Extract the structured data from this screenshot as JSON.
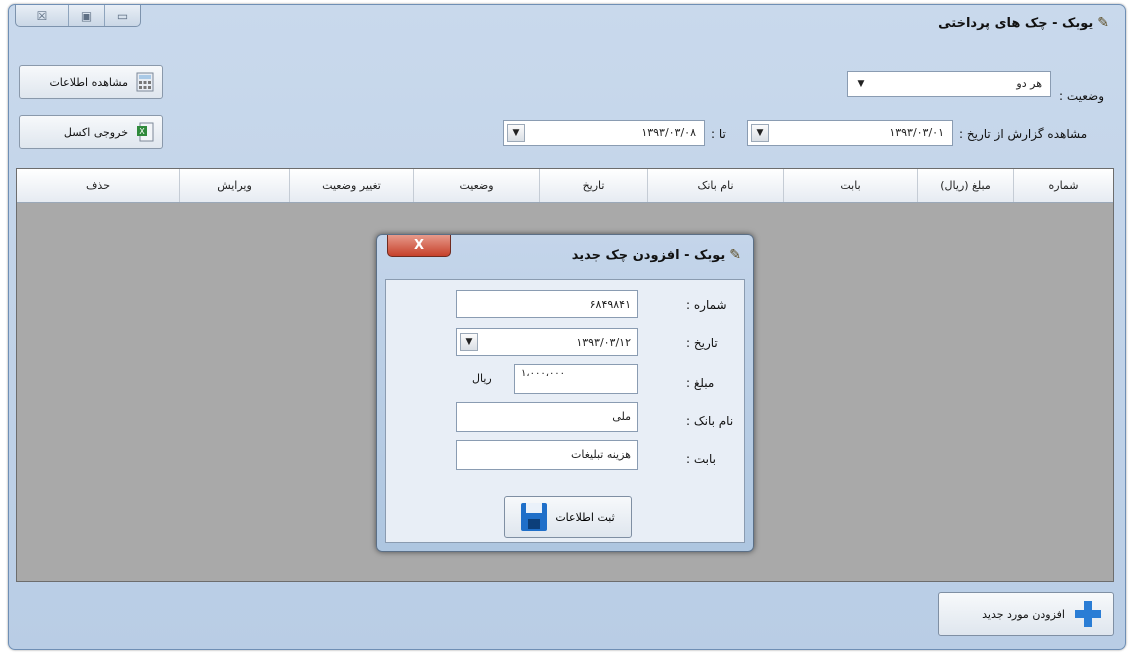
{
  "window": {
    "title": "یوبک - چک های پرداختی",
    "controls": [
      "☒",
      "▣",
      "▭"
    ]
  },
  "toolbar": {
    "view_info_label": "مشاهده اطلاعات",
    "excel_label": "خروجی اکسل"
  },
  "filters": {
    "status_label": "وضعیت :",
    "status_value": "هر دو",
    "report_from_label": "مشاهده گزارش از تاریخ :",
    "from_date": "۱۳۹۳/۰۳/۰۱",
    "to_label": "تا :",
    "to_date": "۱۳۹۳/۰۳/۰۸"
  },
  "grid": {
    "columns": [
      "شماره",
      "مبلغ (ریال)",
      "بابت",
      "نام بانک",
      "تاریخ",
      "وضعیت",
      "تغییر وضعیت",
      "ویرایش",
      "حذف"
    ]
  },
  "add_new_button": "افزودن مورد جدید",
  "dialog": {
    "title": "یوبک - افزودن چک جدید",
    "close": "X",
    "number_label": "شماره :",
    "number_value": "۶۸۴۹۸۴۱",
    "date_label": "تاریخ :",
    "date_value": "۱۳۹۳/۰۳/۱۲",
    "amount_label": "مبلغ :",
    "amount_value": "۱،۰۰۰،۰۰۰",
    "currency": "ریال",
    "bank_label": "نام بانک :",
    "bank_value": "ملی",
    "for_label": "بابت :",
    "for_value": "هزینه تبلیغات",
    "save_label": "ثبت اطلاعات"
  }
}
